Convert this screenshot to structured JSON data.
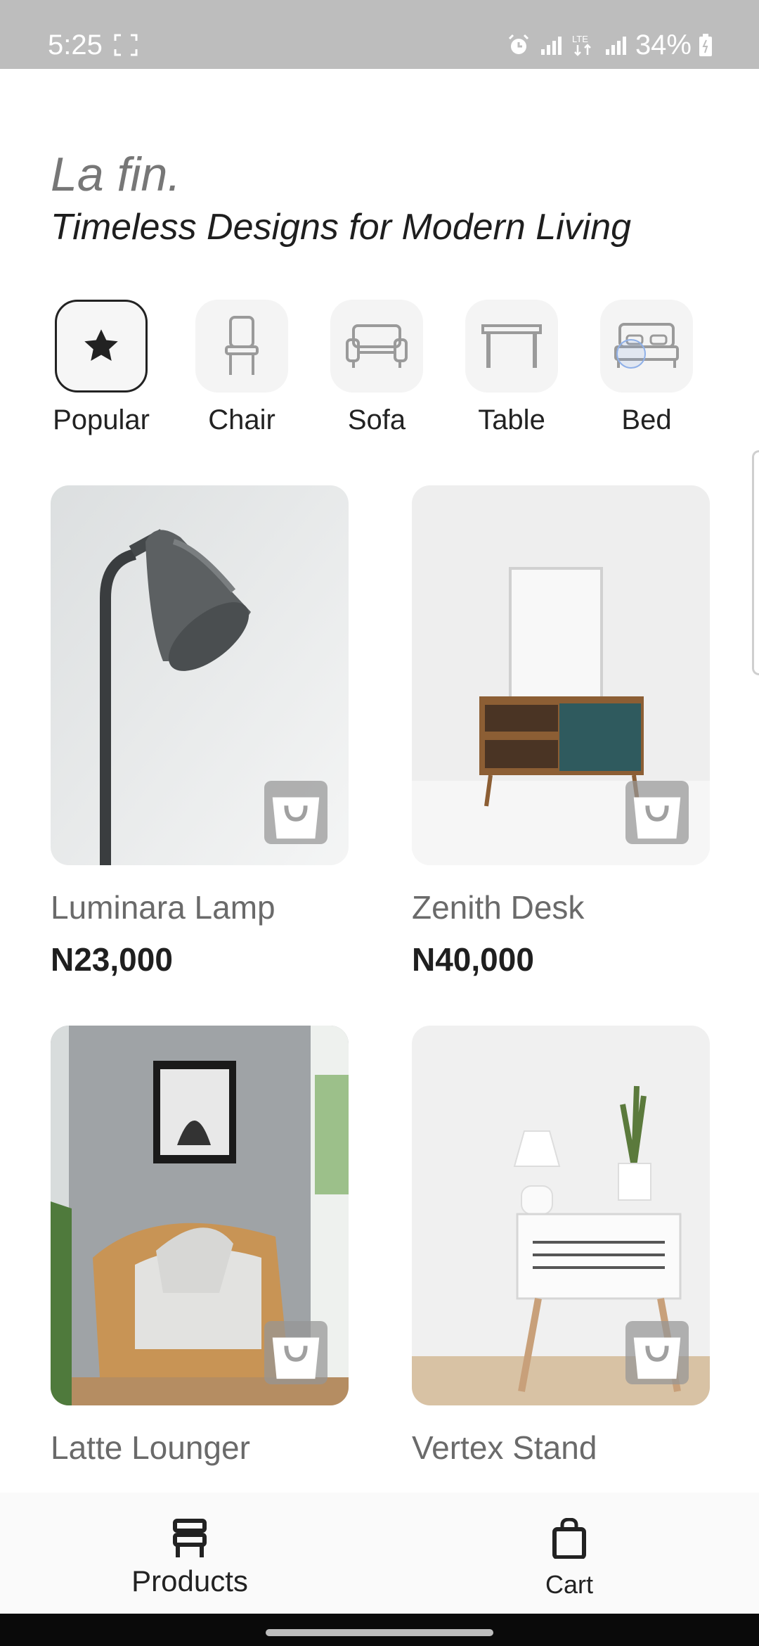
{
  "status_bar": {
    "time": "5:25",
    "battery": "34%",
    "icons": [
      "screenshot-icon",
      "alarm-icon",
      "signal-icon",
      "lte-icon",
      "signal-icon",
      "battery-icon"
    ]
  },
  "header": {
    "brand": "La fin.",
    "tagline": "Timeless Designs for Modern Living"
  },
  "categories": [
    {
      "label": "Popular",
      "icon": "star-icon",
      "active": true
    },
    {
      "label": "Chair",
      "icon": "chair-icon",
      "active": false
    },
    {
      "label": "Sofa",
      "icon": "sofa-icon",
      "active": false
    },
    {
      "label": "Table",
      "icon": "table-icon",
      "active": false
    },
    {
      "label": "Bed",
      "icon": "bed-icon",
      "active": false
    }
  ],
  "products": [
    {
      "name": "Luminara Lamp",
      "price": "N23,000"
    },
    {
      "name": "Zenith Desk",
      "price": "N40,000"
    },
    {
      "name": "Latte Lounger",
      "price": ""
    },
    {
      "name": "Vertex Stand",
      "price": ""
    }
  ],
  "bottom_nav": [
    {
      "label": "Products",
      "icon": "store-icon"
    },
    {
      "label": "Cart",
      "icon": "shopping-bag-icon"
    }
  ]
}
